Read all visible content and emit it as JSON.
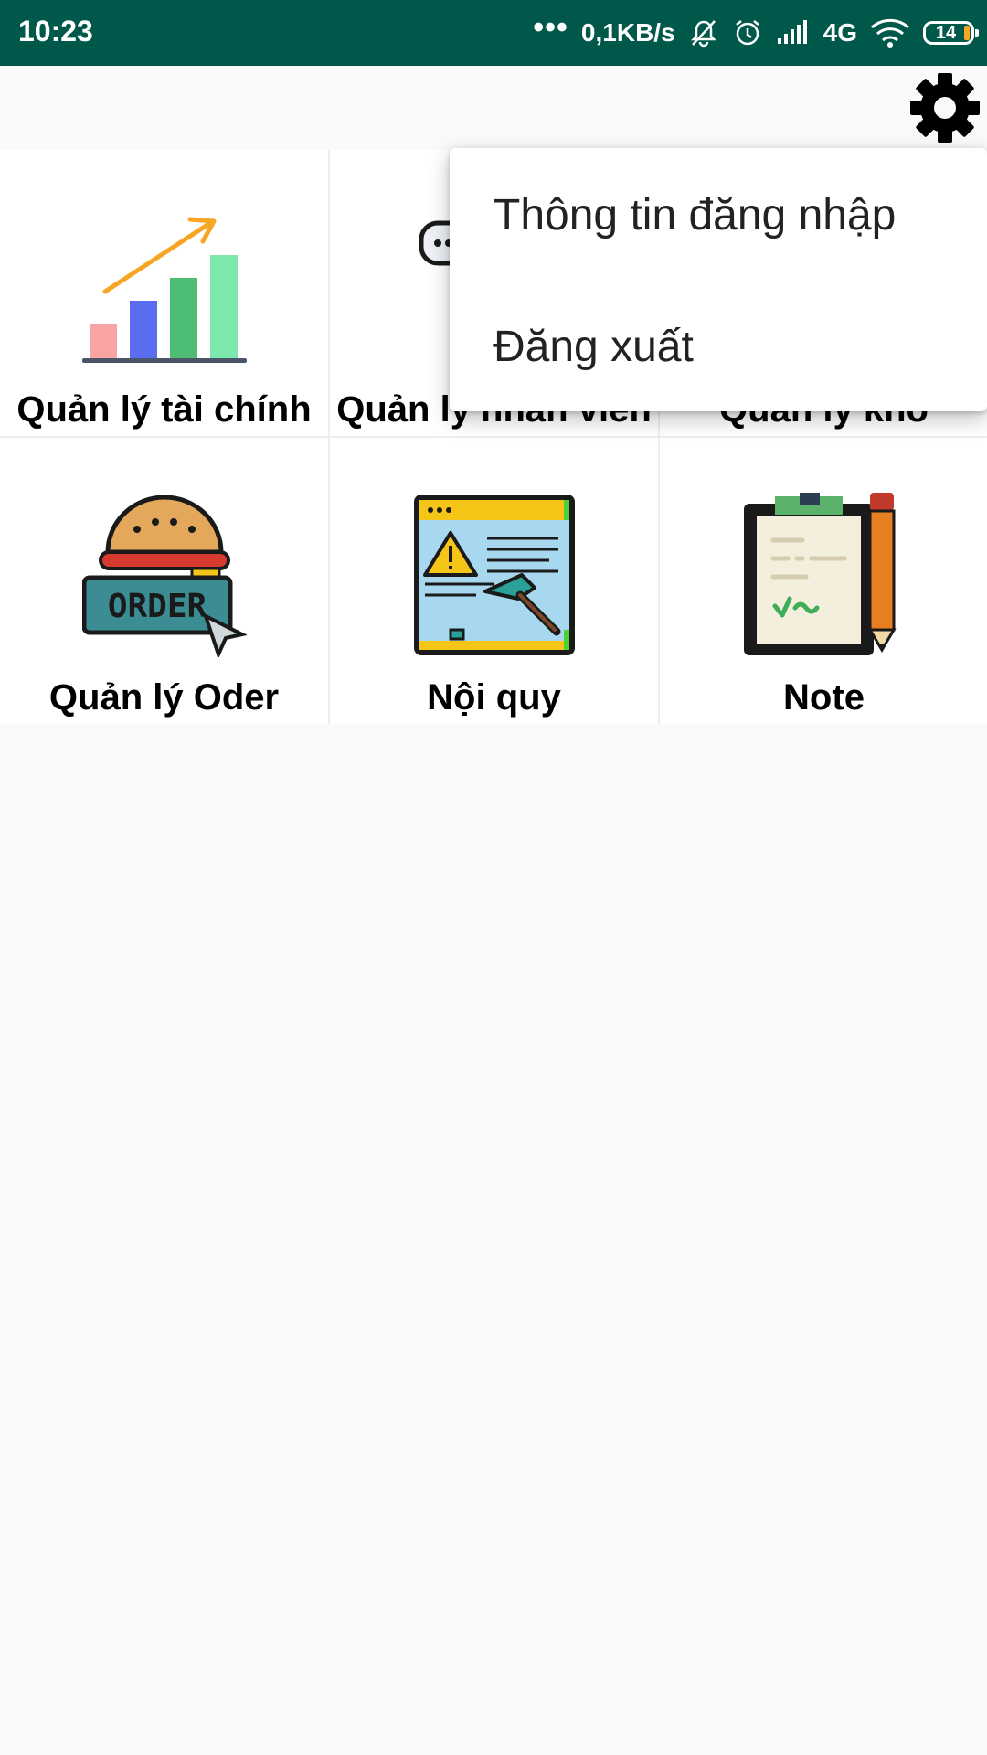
{
  "status_bar": {
    "time": "10:23",
    "more": "•••",
    "speed": "0,1KB/s",
    "network": "4G",
    "battery": "14",
    "background": "#00584a"
  },
  "toolbar": {
    "settings_icon": "gear-icon"
  },
  "tiles": [
    {
      "label": "Quản lý tài chính",
      "icon": "finance-chart-icon"
    },
    {
      "label": "Quản lý nhân viên",
      "icon": "staff-icon"
    },
    {
      "label": "Quản lý kho",
      "icon": "warehouse-icon"
    },
    {
      "label": "Quản lý Oder",
      "icon": "order-burger-icon"
    },
    {
      "label": "Nội quy",
      "icon": "rules-hammer-icon"
    },
    {
      "label": "Note",
      "icon": "clipboard-note-icon"
    }
  ],
  "overflow_menu": {
    "items": [
      {
        "label": "Thông tin đăng nhập"
      },
      {
        "label": "Đăng xuất"
      }
    ]
  }
}
